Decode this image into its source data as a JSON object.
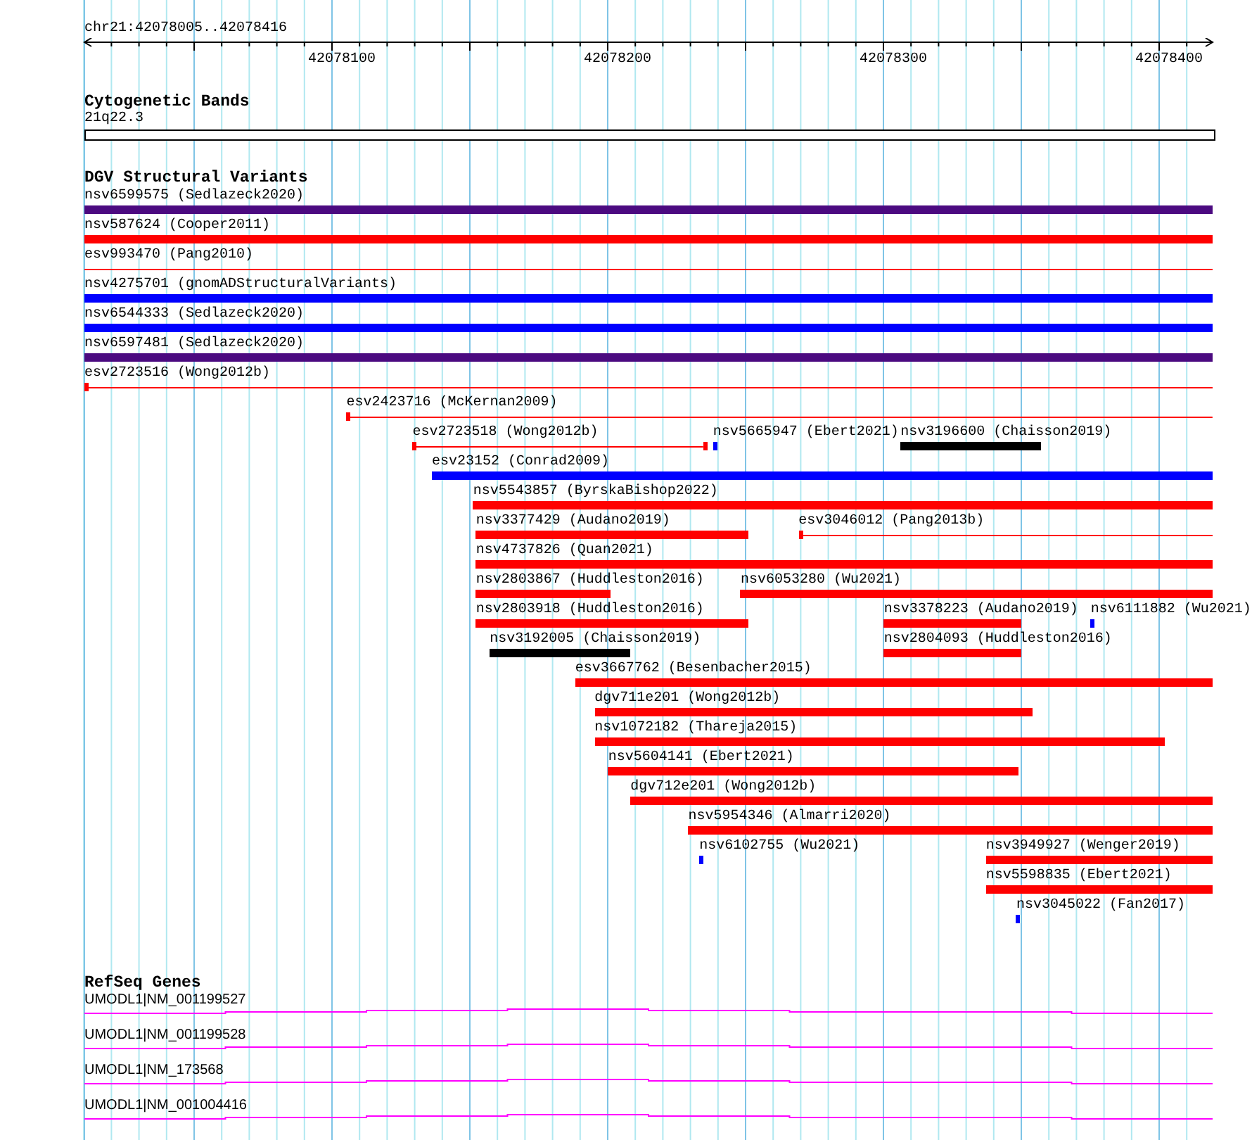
{
  "ruler": {
    "location": "chr21:42078005..42078416",
    "ticks": [
      "42078100",
      "42078200",
      "42078300",
      "42078400"
    ]
  },
  "tracks": [
    {
      "kind": "cytoband",
      "title": "Cytogenetic Bands",
      "band": "21q22.3"
    },
    {
      "kind": "variants",
      "title": "DGV Structural Variants",
      "rows": [
        {
          "features": [
            {
              "name": "nsv6599575 (Sedlazeck2020)",
              "kind": "bar",
              "color": "#4b0a80"
            }
          ]
        },
        {
          "features": [
            {
              "name": "nsv587624 (Cooper2011)",
              "kind": "bar",
              "color": "#ff0000"
            }
          ]
        },
        {
          "features": [
            {
              "name": "esv993470 (Pang2010)",
              "kind": "line",
              "color": "#ff0000"
            }
          ]
        },
        {
          "features": [
            {
              "name": "nsv4275701 (gnomADStructuralVariants)",
              "kind": "bar",
              "color": "#0000ff"
            }
          ]
        },
        {
          "features": [
            {
              "name": "nsv6544333 (Sedlazeck2020)",
              "kind": "bar",
              "color": "#0000ff"
            }
          ]
        },
        {
          "features": [
            {
              "name": "nsv6597481 (Sedlazeck2020)",
              "kind": "bar",
              "color": "#4b0a80"
            }
          ]
        },
        {
          "features": [
            {
              "name": "esv2723516 (Wong2012b)",
              "kind": "line",
              "color": "#ff0000"
            }
          ]
        },
        {
          "features": [
            {
              "name": "esv2423716 (McKernan2009)",
              "kind": "line",
              "color": "#ff0000"
            }
          ]
        },
        {
          "features": [
            {
              "name": "esv2723518 (Wong2012b)",
              "kind": "line",
              "color": "#ff0000"
            },
            {
              "name": "nsv5665947 (Ebert2021)",
              "kind": "bar",
              "color": "#0000ff"
            },
            {
              "name": "nsv3196600 (Chaisson2019)",
              "kind": "bar",
              "color": "#000000"
            }
          ]
        },
        {
          "features": [
            {
              "name": "esv23152 (Conrad2009)",
              "kind": "bar",
              "color": "#0000ff"
            }
          ]
        },
        {
          "features": [
            {
              "name": "nsv5543857 (ByrskaBishop2022)",
              "kind": "bar",
              "color": "#ff0000"
            }
          ]
        },
        {
          "features": [
            {
              "name": "nsv3377429 (Audano2019)",
              "kind": "bar",
              "color": "#ff0000"
            },
            {
              "name": "esv3046012 (Pang2013b)",
              "kind": "line",
              "color": "#ff0000"
            }
          ]
        },
        {
          "features": [
            {
              "name": "nsv4737826 (Quan2021)",
              "kind": "bar",
              "color": "#ff0000"
            }
          ]
        },
        {
          "features": [
            {
              "name": "nsv2803867 (Huddleston2016)",
              "kind": "bar",
              "color": "#ff0000"
            },
            {
              "name": "nsv6053280 (Wu2021)",
              "kind": "bar",
              "color": "#ff0000"
            }
          ]
        },
        {
          "features": [
            {
              "name": "nsv2803918 (Huddleston2016)",
              "kind": "bar",
              "color": "#ff0000"
            },
            {
              "name": "nsv3378223 (Audano2019)",
              "kind": "bar",
              "color": "#ff0000"
            },
            {
              "name": "nsv6111882 (Wu2021)",
              "kind": "bar",
              "color": "#0000ff"
            }
          ]
        },
        {
          "features": [
            {
              "name": "nsv3192005 (Chaisson2019)",
              "kind": "bar",
              "color": "#000000"
            },
            {
              "name": "nsv2804093 (Huddleston2016)",
              "kind": "bar",
              "color": "#ff0000"
            }
          ]
        },
        {
          "features": [
            {
              "name": "esv3667762 (Besenbacher2015)",
              "kind": "bar",
              "color": "#ff0000"
            }
          ]
        },
        {
          "features": [
            {
              "name": "dgv711e201 (Wong2012b)",
              "kind": "bar",
              "color": "#ff0000"
            }
          ]
        },
        {
          "features": [
            {
              "name": "nsv1072182 (Thareja2015)",
              "kind": "bar",
              "color": "#ff0000"
            }
          ]
        },
        {
          "features": [
            {
              "name": "nsv5604141 (Ebert2021)",
              "kind": "bar",
              "color": "#ff0000"
            }
          ]
        },
        {
          "features": [
            {
              "name": "dgv712e201 (Wong2012b)",
              "kind": "bar",
              "color": "#ff0000"
            }
          ]
        },
        {
          "features": [
            {
              "name": "nsv5954346 (Almarri2020)",
              "kind": "bar",
              "color": "#ff0000"
            }
          ]
        },
        {
          "features": [
            {
              "name": "nsv6102755 (Wu2021)",
              "kind": "bar",
              "color": "#0000ff"
            },
            {
              "name": "nsv3949927 (Wenger2019)",
              "kind": "bar",
              "color": "#ff0000"
            }
          ]
        },
        {
          "features": [
            {
              "name": "nsv5598835 (Ebert2021)",
              "kind": "bar",
              "color": "#ff0000"
            }
          ]
        },
        {
          "features": [
            {
              "name": "nsv3045022 (Fan2017)",
              "kind": "bar",
              "color": "#0000ff"
            }
          ]
        }
      ]
    },
    {
      "kind": "genes",
      "title": "RefSeq Genes",
      "transcripts": [
        {
          "name": "UMODL1|NM_001199527"
        },
        {
          "name": "UMODL1|NM_001199528"
        },
        {
          "name": "UMODL1|NM_173568"
        },
        {
          "name": "UMODL1|NM_001004416"
        }
      ]
    }
  ]
}
